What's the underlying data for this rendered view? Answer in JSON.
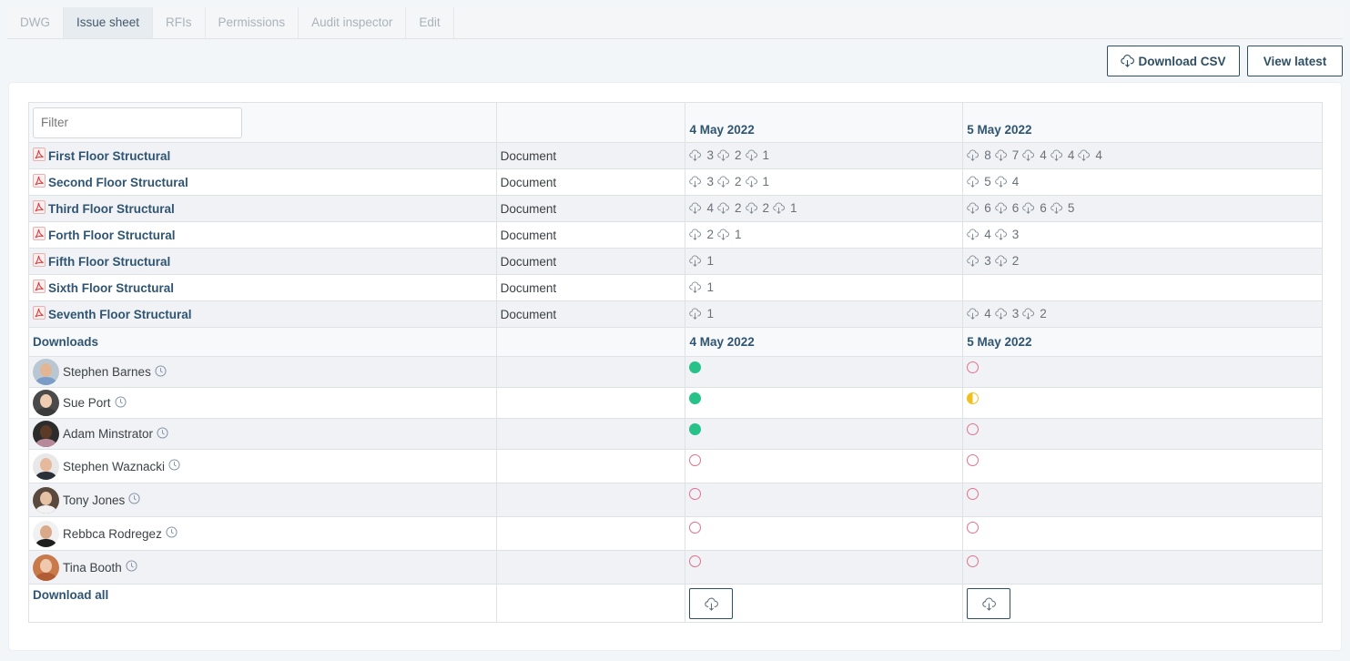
{
  "tabs": [
    {
      "label": "DWG",
      "active": false
    },
    {
      "label": "Issue sheet",
      "active": true
    },
    {
      "label": "RFIs",
      "active": false
    },
    {
      "label": "Permissions",
      "active": false
    },
    {
      "label": "Audit inspector",
      "active": false
    },
    {
      "label": "Edit",
      "active": false
    }
  ],
  "toolbar": {
    "download_csv_label": "Download CSV",
    "download_csv_icon": "cloud-download-icon",
    "view_latest_label": "View latest"
  },
  "filter": {
    "placeholder": "Filter",
    "value": ""
  },
  "dates": [
    "4 May 2022",
    "5 May 2022"
  ],
  "documents": [
    {
      "name": "First Floor Structural",
      "type": "Document",
      "icon": "pdf-icon",
      "downloads": [
        [
          3,
          2,
          1
        ],
        [
          8,
          7,
          4,
          4,
          4
        ]
      ]
    },
    {
      "name": "Second Floor Structural",
      "type": "Document",
      "icon": "pdf-icon",
      "downloads": [
        [
          3,
          2,
          1
        ],
        [
          5,
          4
        ]
      ]
    },
    {
      "name": "Third Floor Structural",
      "type": "Document",
      "icon": "pdf-icon",
      "downloads": [
        [
          4,
          2,
          2,
          1
        ],
        [
          6,
          6,
          6,
          5
        ]
      ]
    },
    {
      "name": "Forth Floor Structural",
      "type": "Document",
      "icon": "pdf-icon",
      "downloads": [
        [
          2,
          1
        ],
        [
          4,
          3
        ]
      ]
    },
    {
      "name": "Fifth Floor Structural",
      "type": "Document",
      "icon": "pdf-icon",
      "downloads": [
        [
          1
        ],
        [
          3,
          2
        ]
      ]
    },
    {
      "name": "Sixth Floor Structural",
      "type": "Document",
      "icon": "pdf-icon",
      "downloads": [
        [
          1
        ],
        []
      ]
    },
    {
      "name": "Seventh Floor Structural",
      "type": "Document",
      "icon": "pdf-icon",
      "downloads": [
        [
          1
        ],
        [
          4,
          3,
          2
        ]
      ]
    }
  ],
  "downloads_section": {
    "title": "Downloads",
    "dates": [
      "4 May 2022",
      "5 May 2022"
    ],
    "people": [
      {
        "name": "Stephen Barnes",
        "status": [
          "full",
          "none"
        ],
        "avatar": {
          "skin": "#e2b694",
          "body": "#7a9cc6",
          "bg": "#b9c7d3"
        }
      },
      {
        "name": "Sue Port",
        "status": [
          "full",
          "half"
        ],
        "avatar": {
          "skin": "#efcdb2",
          "body": "#3b3b3b",
          "bg": "#4a4a4a"
        }
      },
      {
        "name": "Adam Minstrator",
        "status": [
          "full",
          "none"
        ],
        "avatar": {
          "skin": "#5b3a27",
          "body": "#b78a9a",
          "bg": "#2c2c2c"
        }
      },
      {
        "name": "Stephen Waznacki",
        "status": [
          "none",
          "none"
        ],
        "avatar": {
          "skin": "#e7b99c",
          "body": "#2a2f3a",
          "bg": "#e8e8e8"
        }
      },
      {
        "name": "Tony Jones",
        "status": [
          "none",
          "none"
        ],
        "avatar": {
          "skin": "#e6c2a5",
          "body": "#f2f2f2",
          "bg": "#5a4a3e"
        }
      },
      {
        "name": "Rebbca Rodregez",
        "status": [
          "none",
          "none"
        ],
        "avatar": {
          "skin": "#d9a98a",
          "body": "#1e1e1e",
          "bg": "#f1f1f1"
        }
      },
      {
        "name": "Tina Booth",
        "status": [
          "none",
          "none"
        ],
        "avatar": {
          "skin": "#f0c8ad",
          "body": "#b15c35",
          "bg": "#c97a4a"
        }
      }
    ],
    "status_legend": {
      "full": "#27c28a",
      "half": "#f2c01e",
      "none": "#e0738b"
    },
    "clock_icon": "clock-icon"
  },
  "footer": {
    "download_all_label": "Download all",
    "download_button_icon": "cloud-download-icon"
  },
  "colors": {
    "accent": "#2f5572",
    "button_border": "#2f4f63"
  }
}
